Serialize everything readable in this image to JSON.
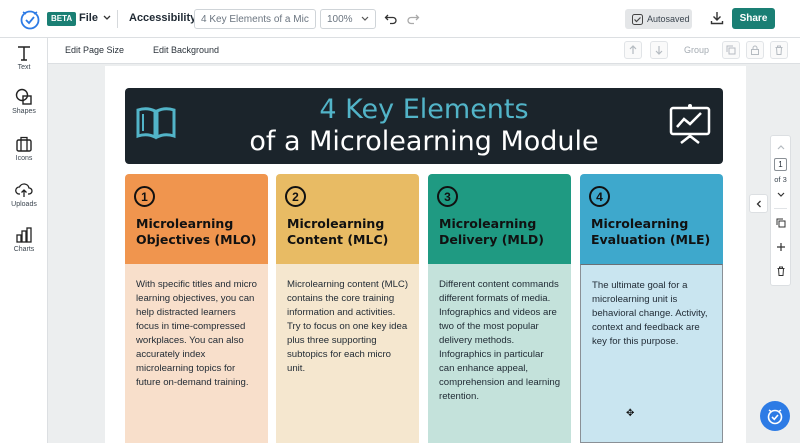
{
  "header": {
    "beta": "BETA",
    "file_label": "File",
    "accessibility_label": "Accessibility",
    "title_value": "4 Key Elements of a Micr...",
    "zoom_value": "100%",
    "autosaved_label": "Autosaved",
    "share_label": "Share"
  },
  "sidebar": {
    "items": [
      {
        "label": "Text",
        "icon": "text-icon"
      },
      {
        "label": "Shapes",
        "icon": "shapes-icon"
      },
      {
        "label": "Icons",
        "icon": "briefcase-icon"
      },
      {
        "label": "Uploads",
        "icon": "upload-icon"
      },
      {
        "label": "Charts",
        "icon": "chart-icon"
      }
    ]
  },
  "toolbar": {
    "edit_page_size": "Edit Page Size",
    "edit_background": "Edit Background",
    "group_label": "Group"
  },
  "canvas": {
    "banner": {
      "line1": "4 Key Elements",
      "line2": "of a Microlearning Module"
    },
    "cards": [
      {
        "number": "1",
        "title": "Microlearning Objectives (MLO)",
        "body": "With specific titles and micro learning objectives, you can help distracted learners focus in time-compressed workplaces. You can also accurately index microlearning topics for future on-demand training.",
        "head_color": "#f0954e",
        "body_color": "#f8dfcb"
      },
      {
        "number": "2",
        "title": "Microlearning Content (MLC)",
        "body": "Microlearning content (MLC) contains the core training information and activities. Try to focus on one key idea plus three supporting subtopics for each micro unit.",
        "head_color": "#e8bb64",
        "body_color": "#f5e7cf"
      },
      {
        "number": "3",
        "title": "Microlearning Delivery (MLD)",
        "body": "Different content commands different formats of media. Infographics and videos are two of the most popular delivery methods. Infographics in particular can enhance appeal, comprehension and learning retention.",
        "head_color": "#1f9a82",
        "body_color": "#c4e2db"
      },
      {
        "number": "4",
        "title": "Microlearning Evaluation (MLE)",
        "body": "The ultimate goal for a microlearning unit is behavioral change. Activity, context and feedback are key for this purpose.",
        "head_color": "#3ea8cc",
        "body_color": "#c9e5f0"
      }
    ]
  },
  "pager": {
    "current": "1",
    "of_label": "of 3"
  },
  "colors": {
    "brand": "#1a7f74",
    "banner_bg": "#1b242b",
    "banner_accent": "#52b4c8",
    "help": "#2d7be5"
  }
}
